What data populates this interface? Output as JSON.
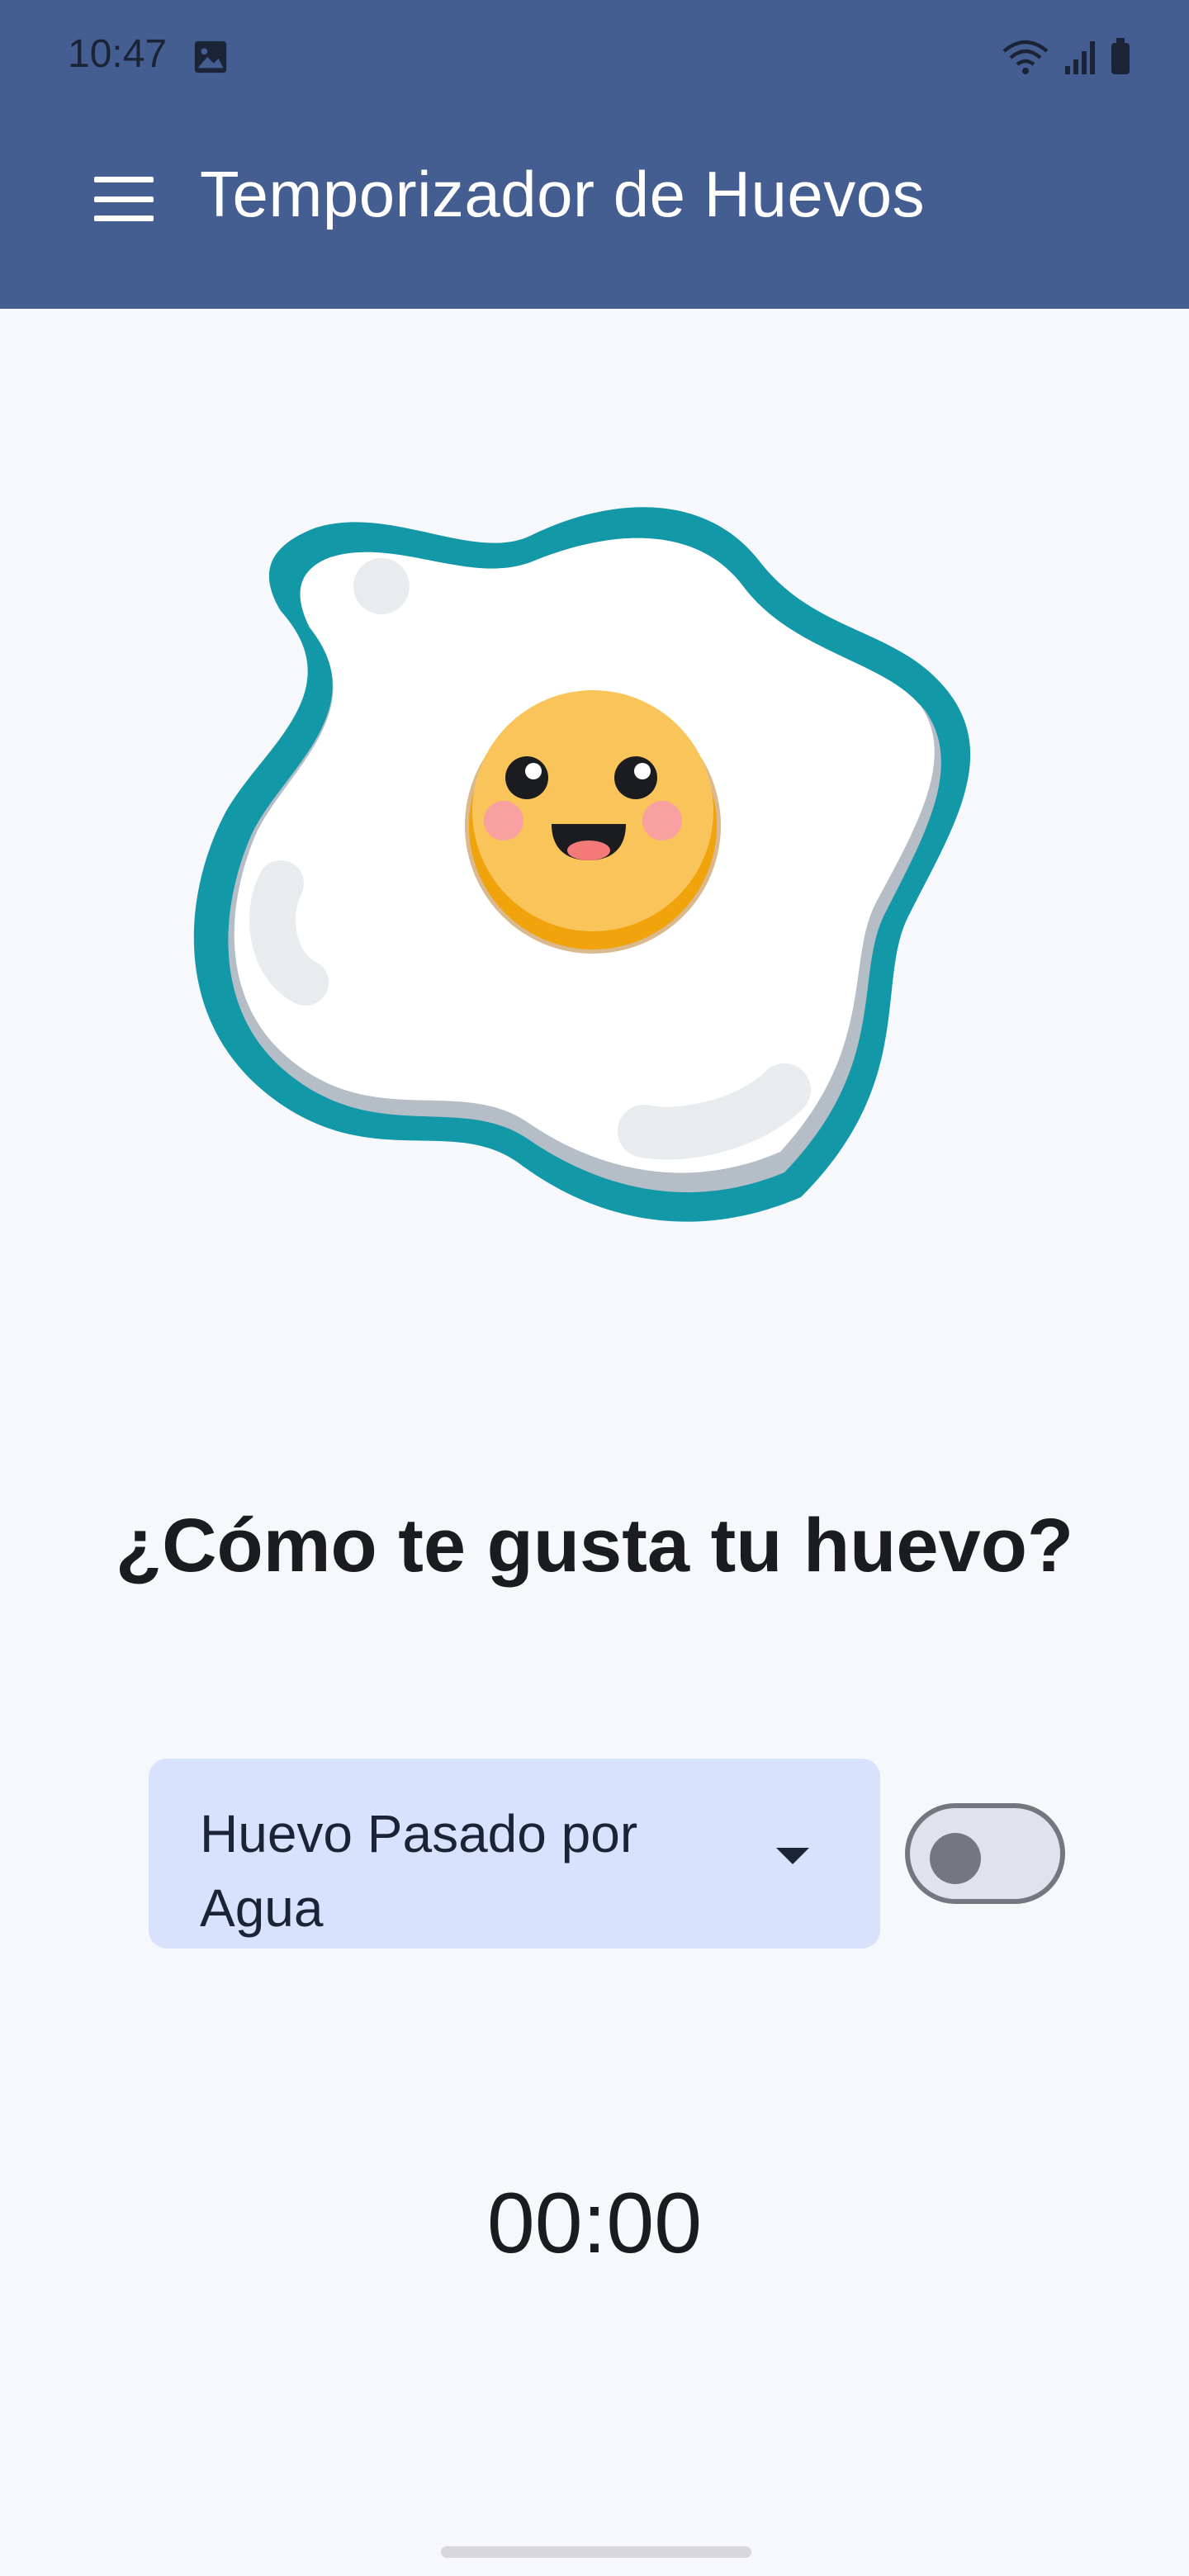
{
  "status_bar": {
    "time": "10:47"
  },
  "app_bar": {
    "title": "Temporizador de Huevos"
  },
  "main": {
    "question": "¿Cómo te gusta tu huevo?",
    "dropdown": {
      "selected": "Huevo Pasado por Agua"
    },
    "switch": {
      "on": false
    },
    "timer": "00:00"
  },
  "colors": {
    "app_bar": "#455e91",
    "background": "#f7f8fc",
    "dropdown_bg": "#d9e2fc",
    "egg_outline": "#1398a8",
    "yolk": "#f9c55a"
  }
}
